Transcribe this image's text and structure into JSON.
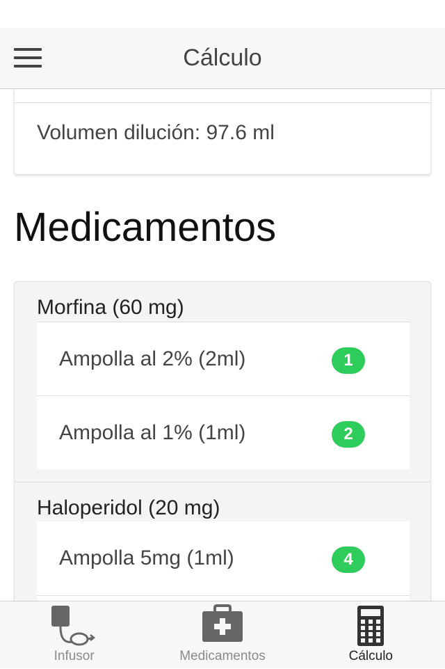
{
  "header": {
    "title": "Cálculo"
  },
  "summary": {
    "volume_text": "Volumen dilución: 97.6 ml"
  },
  "section": {
    "title": "Medicamentos"
  },
  "medications": [
    {
      "title": "Morfina (60 mg)",
      "items": [
        {
          "label": "Ampolla al 2% (2ml)",
          "count": "1"
        },
        {
          "label": "Ampolla al 1% (1ml)",
          "count": "2"
        }
      ]
    },
    {
      "title": "Haloperidol (20 mg)",
      "items": [
        {
          "label": "Ampolla 5mg (1ml)",
          "count": "4"
        }
      ]
    }
  ],
  "tabbar": {
    "tabs": [
      {
        "label": "Infusor",
        "icon": "infusor-icon",
        "active": false
      },
      {
        "label": "Medicamentos",
        "icon": "medkit-icon",
        "active": false
      },
      {
        "label": "Cálculo",
        "icon": "calculator-icon",
        "active": true
      }
    ]
  },
  "colors": {
    "badge": "#2ecc5a",
    "navbar_bg": "#f7f7f7"
  }
}
